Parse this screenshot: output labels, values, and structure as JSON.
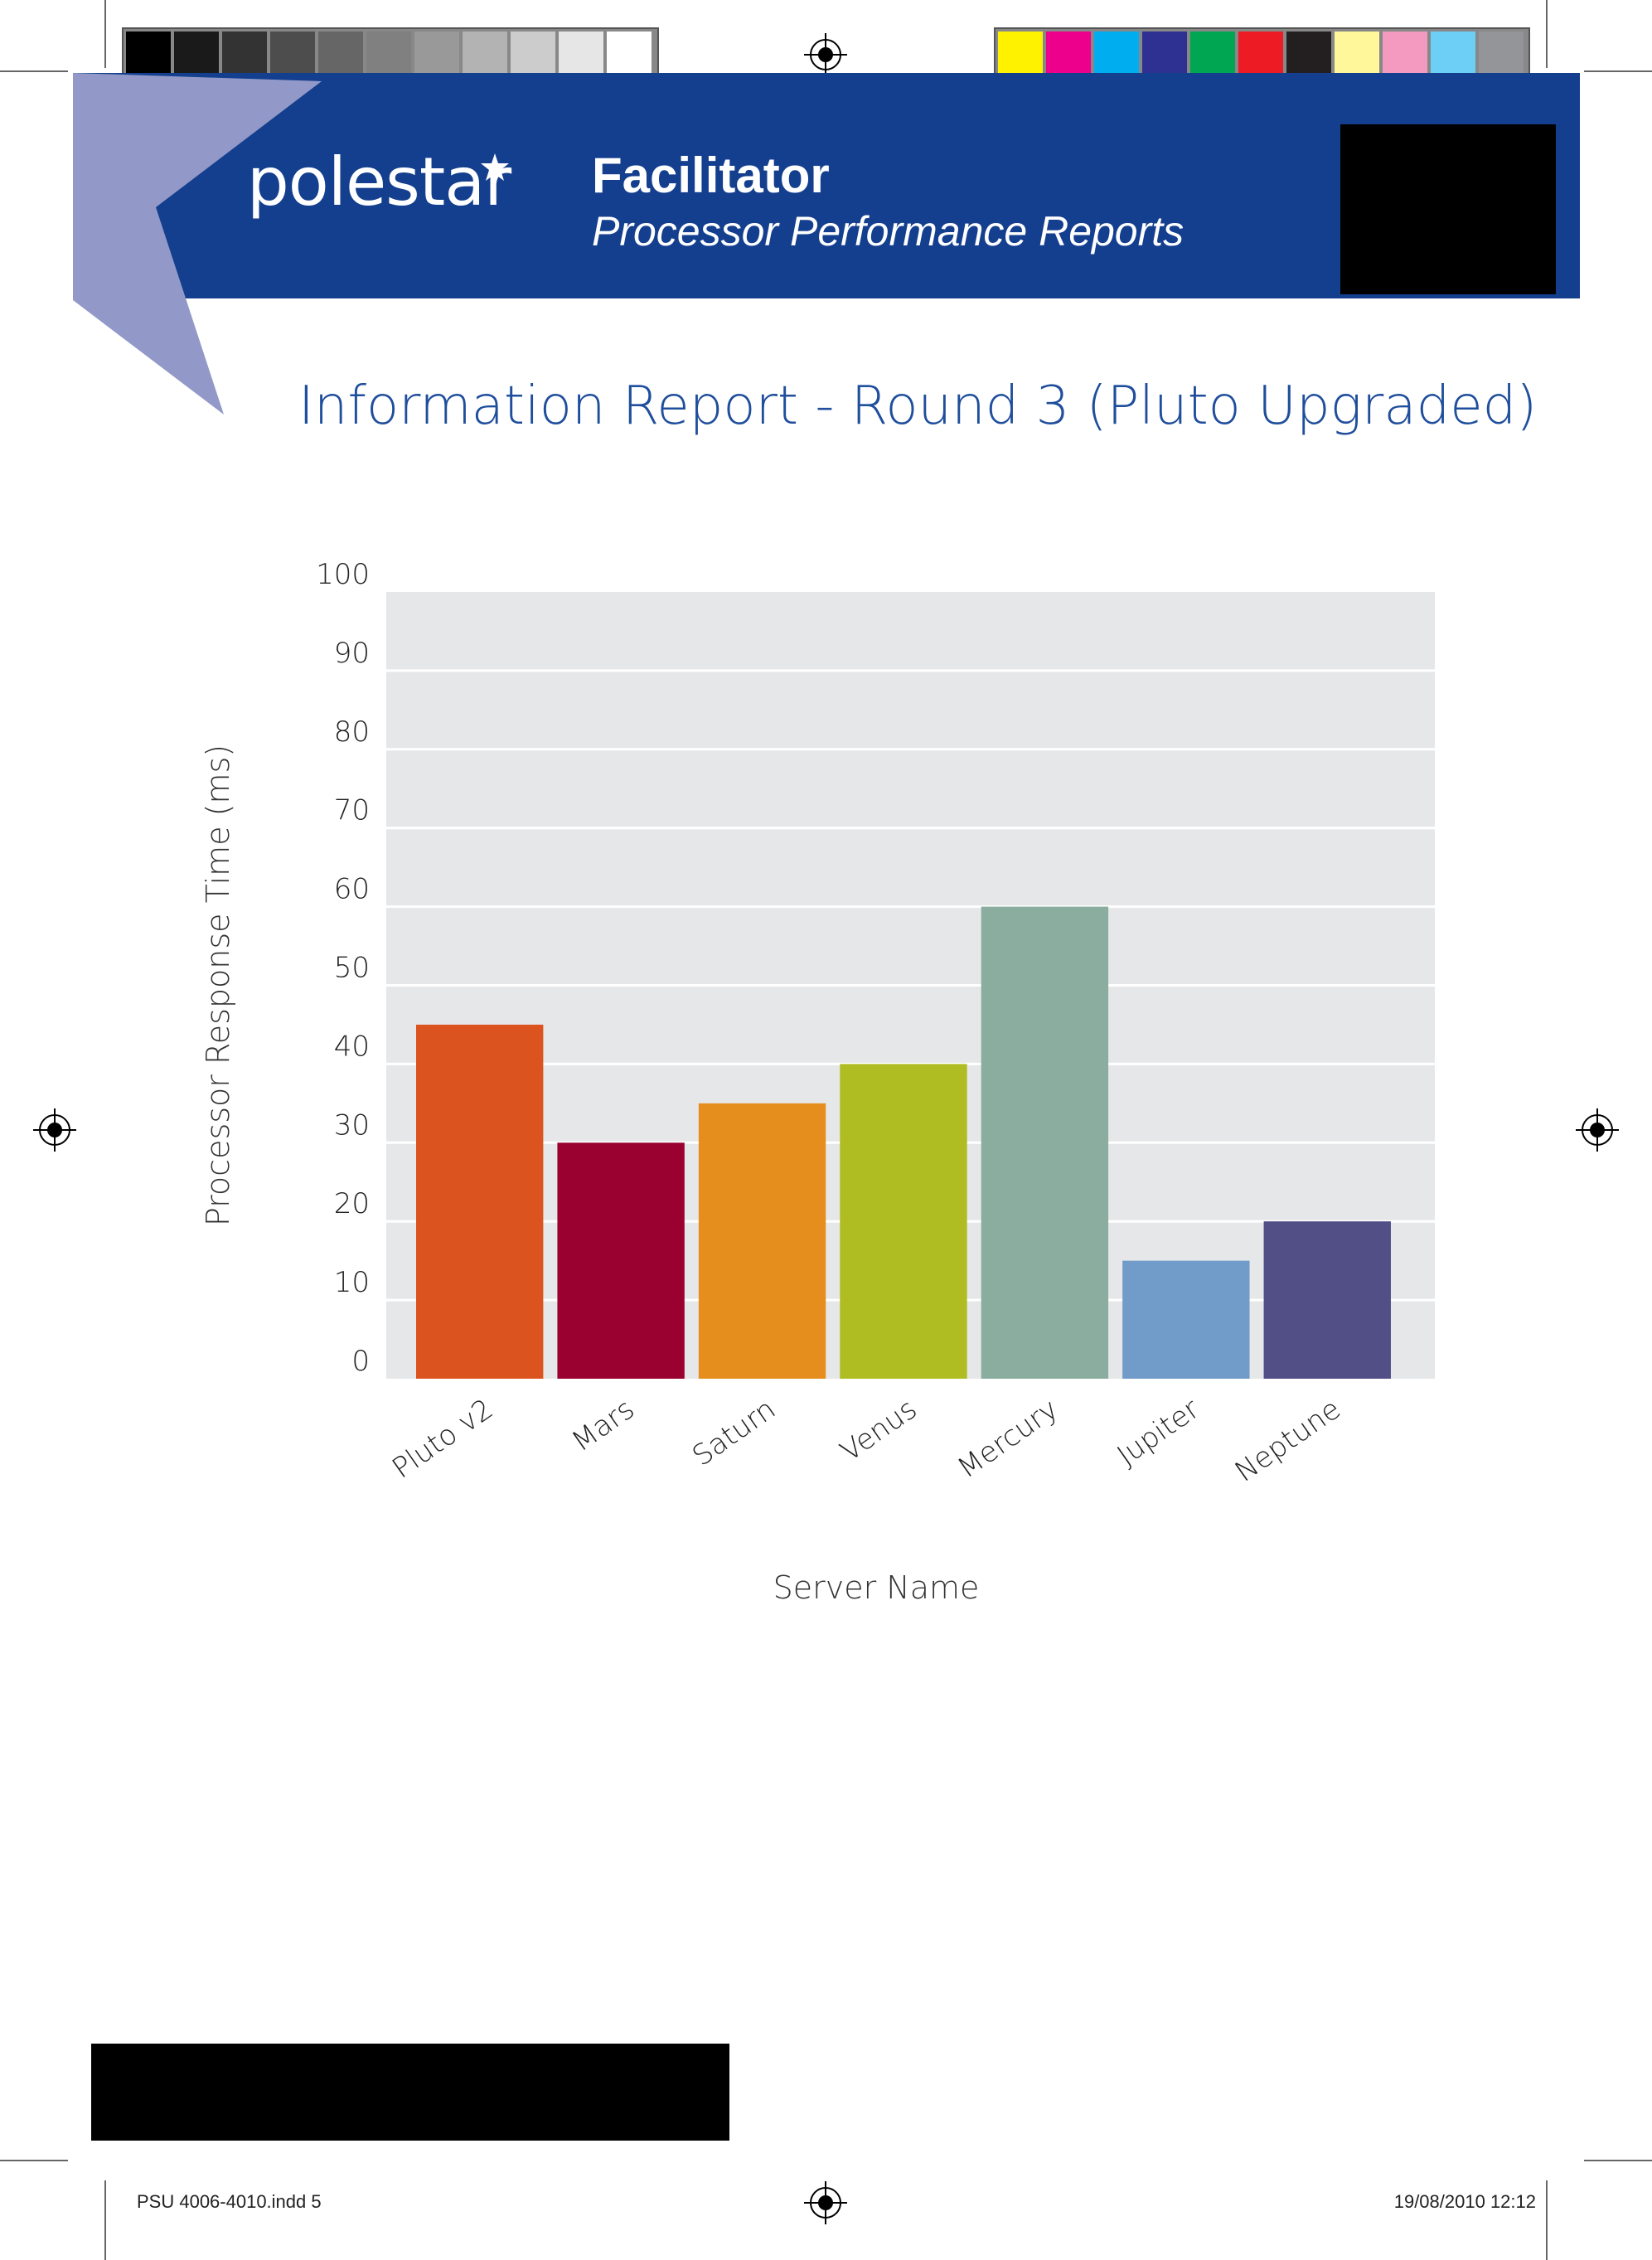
{
  "header": {
    "brand": "polestar",
    "title": "Facilitator",
    "subtitle": "Processor Performance Reports"
  },
  "report_title": "Information Report  - Round 3 (Pluto Upgraded)",
  "colors": {
    "header_band": "#143f8e",
    "header_swoosh": "#9299c8",
    "title_text": "#1f4e9c",
    "plot_background": "#e6e7e9",
    "gridline": "#ffffff"
  },
  "print_marks": {
    "grayscale_swatches": [
      "#000000",
      "#1a1a1a",
      "#333333",
      "#4d4d4d",
      "#666666",
      "#808080",
      "#999999",
      "#b3b3b3",
      "#cccccc",
      "#e6e6e6",
      "#ffffff"
    ],
    "color_swatches": [
      "#fff200",
      "#ec008c",
      "#00aeef",
      "#2e3192",
      "#00a651",
      "#ed1c24",
      "#231f20",
      "#fff799",
      "#f49ac1",
      "#6dcff6",
      "#939598"
    ]
  },
  "footer": {
    "file_label": "PSU 4006-4010.indd   5",
    "date_label": "19/08/2010   12:12"
  },
  "chart_data": {
    "type": "bar",
    "categories": [
      "Pluto v2",
      "Mars",
      "Saturn",
      "Venus",
      "Mercury",
      "Jupiter",
      "Neptune"
    ],
    "values": [
      45,
      30,
      35,
      40,
      60,
      15,
      20
    ],
    "colors": [
      "#db531f",
      "#9a0030",
      "#e68e1d",
      "#afbd22",
      "#8aad9f",
      "#719bc8",
      "#524f87"
    ],
    "title": "",
    "xlabel": "Server Name",
    "ylabel": "Processor Response Time (ms)",
    "ylim": [
      0,
      100
    ],
    "yticks": [
      0,
      10,
      20,
      30,
      40,
      50,
      60,
      70,
      80,
      90,
      100
    ],
    "grid": true,
    "legend": "none"
  }
}
